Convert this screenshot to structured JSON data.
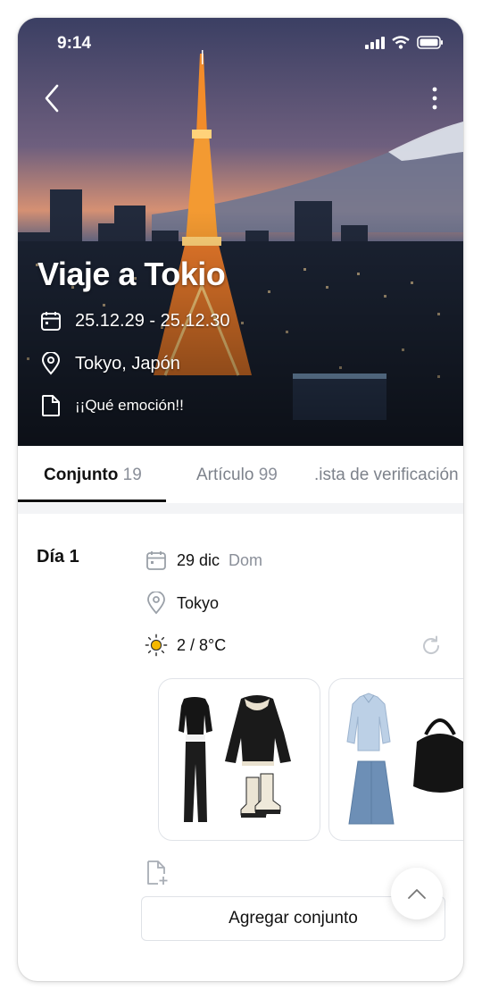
{
  "status_bar": {
    "time": "9:14"
  },
  "trip": {
    "title": "Viaje a Tokio",
    "dates": "25.12.29 - 25.12.30",
    "location": "Tokyo, Japón",
    "note": "¡¡Qué emoción!!"
  },
  "tabs": [
    {
      "label": "Conjunto",
      "count": "19",
      "active": true
    },
    {
      "label": "Artículo",
      "count": "99"
    },
    {
      "label": ".ista de verificación"
    }
  ],
  "day": {
    "label": "Día 1",
    "date": "29 dic",
    "weekday": "Dom",
    "place": "Tokyo",
    "weather": "2 / 8°C",
    "weather_icon": "sun-icon"
  },
  "outfits": [
    {
      "items": [
        "black-top",
        "black-leather-jacket",
        "black-trousers",
        "cream-boots"
      ]
    },
    {
      "items": [
        "light-blue-shirt",
        "denim-skirt",
        "black-handbag"
      ]
    }
  ],
  "actions": {
    "add_outfit": "Agregar conjunto"
  },
  "colors": {
    "accent": "#111111",
    "muted": "#8a8f99",
    "weather_sun": "#f5b800"
  }
}
